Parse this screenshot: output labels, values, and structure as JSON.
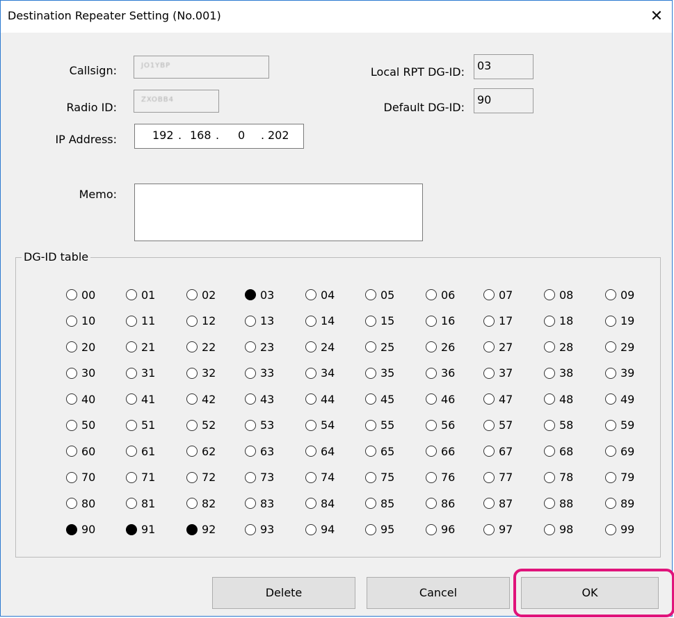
{
  "window": {
    "title": "Destination Repeater Setting (No.001)",
    "close_glyph": "✕"
  },
  "fields": {
    "callsign_label": "Callsign:",
    "callsign_value": "JO1YBP",
    "radio_id_label": "Radio ID:",
    "radio_id_value": "ZXOBB4",
    "ip_label": "IP Address:",
    "ip": [
      "192",
      "168",
      "0",
      "202"
    ],
    "memo_label": "Memo:",
    "memo_value": "",
    "local_rpt_label": "Local RPT DG-ID:",
    "local_rpt_value": "03",
    "default_dgid_label": "Default DG-ID:",
    "default_dgid_value": "90"
  },
  "dgid_table": {
    "label": "DG-ID table",
    "selected": [
      "03",
      "90",
      "91",
      "92"
    ]
  },
  "buttons": {
    "delete": "Delete",
    "cancel": "Cancel",
    "ok": "OK"
  },
  "colors": {
    "highlight": "#e0147b",
    "window_border": "#2b79d0"
  }
}
